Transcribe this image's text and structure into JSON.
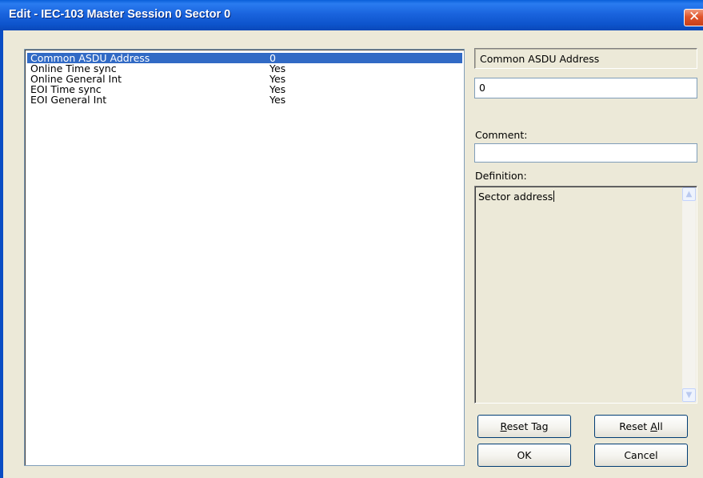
{
  "window": {
    "title": "Edit - IEC-103 Master Session 0 Sector 0",
    "close_glyph": "✕"
  },
  "list": {
    "rows": [
      {
        "name": "Common ASDU Address",
        "value": "0",
        "selected": true
      },
      {
        "name": "Online Time sync",
        "value": "Yes",
        "selected": false
      },
      {
        "name": "Online General Int",
        "value": "Yes",
        "selected": false
      },
      {
        "name": "EOI Time sync",
        "value": "Yes",
        "selected": false
      },
      {
        "name": "EOI General Int",
        "value": "Yes",
        "selected": false
      }
    ]
  },
  "panel": {
    "tag_name": "Common ASDU Address",
    "value": "0",
    "comment_label": "Comment:",
    "comment_value": "",
    "definition_label": "Definition:",
    "definition_text": "Sector address"
  },
  "buttons": {
    "reset_tag": {
      "before": "",
      "accel": "R",
      "after": "eset Tag"
    },
    "reset_all": {
      "before": "Reset ",
      "accel": "A",
      "after": "ll"
    },
    "ok": "OK",
    "cancel": "Cancel"
  },
  "icons": {
    "scroll_up": "scroll-up-arrow-icon",
    "scroll_down": "scroll-down-arrow-icon",
    "close": "close-icon"
  }
}
